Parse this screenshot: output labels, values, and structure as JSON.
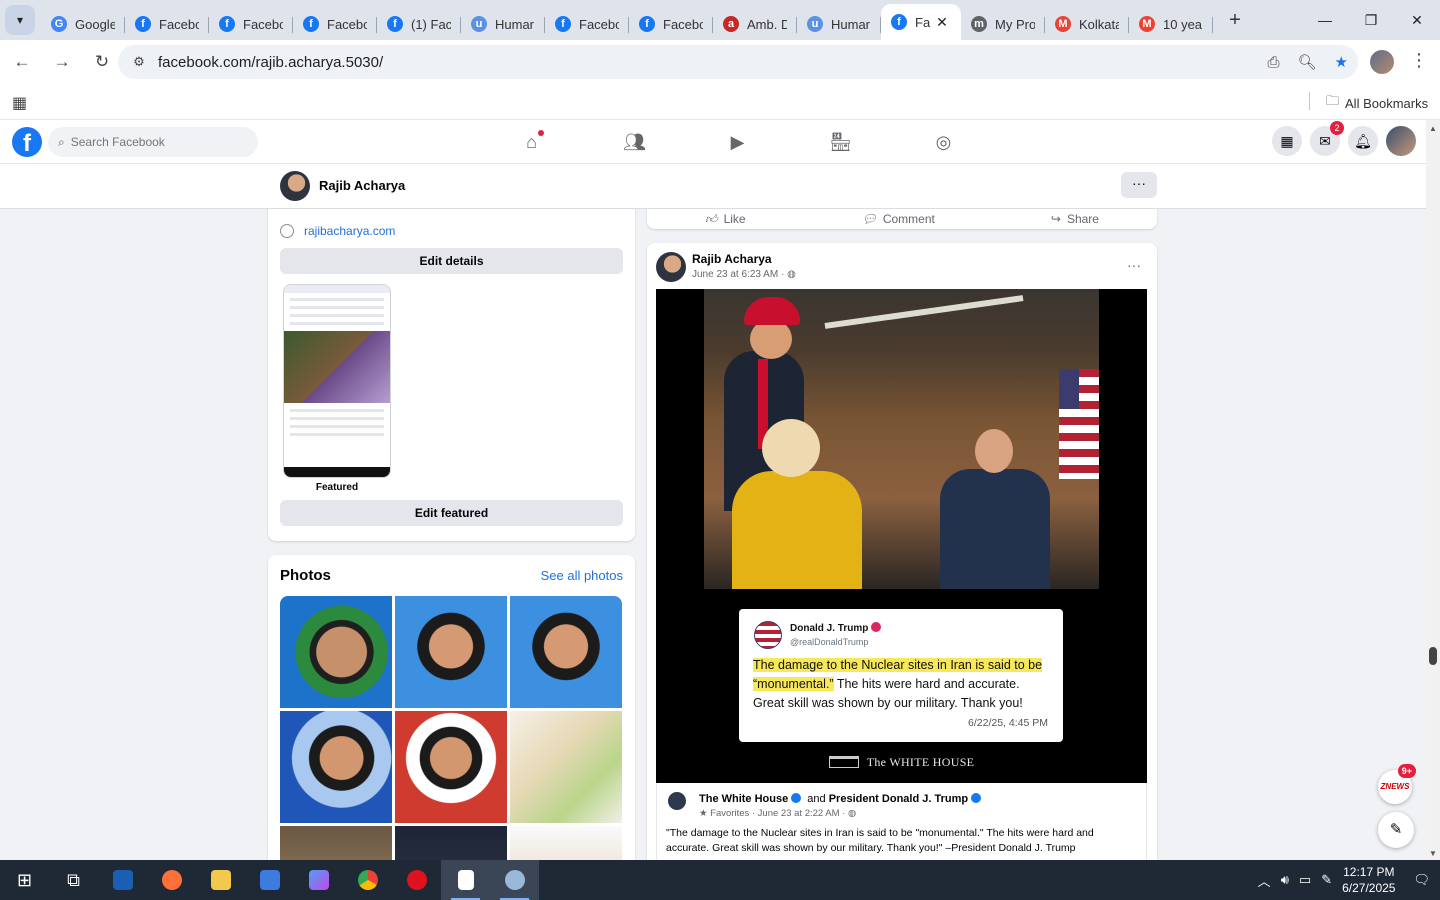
{
  "browser": {
    "tabs": [
      {
        "title": "Google",
        "favicon_color": "#4285f4",
        "favicon_glyph": "G"
      },
      {
        "title": "Facebo",
        "favicon_color": "#1877f2",
        "favicon_glyph": "f"
      },
      {
        "title": "Facebo",
        "favicon_color": "#1877f2",
        "favicon_glyph": "f"
      },
      {
        "title": "Facebo",
        "favicon_color": "#1877f2",
        "favicon_glyph": "f"
      },
      {
        "title": "(1) Fac",
        "favicon_color": "#1877f2",
        "favicon_glyph": "f"
      },
      {
        "title": "Humar",
        "favicon_color": "#5b92e5",
        "favicon_glyph": "u"
      },
      {
        "title": "Facebo",
        "favicon_color": "#1877f2",
        "favicon_glyph": "f"
      },
      {
        "title": "Facebo",
        "favicon_color": "#1877f2",
        "favicon_glyph": "f"
      },
      {
        "title": "Amb. D",
        "favicon_color": "#c62828",
        "favicon_glyph": "a"
      },
      {
        "title": "Humar",
        "favicon_color": "#5b92e5",
        "favicon_glyph": "u"
      },
      {
        "title": "Fa",
        "favicon_color": "#1877f2",
        "favicon_glyph": "f",
        "active": true
      },
      {
        "title": "My Pro",
        "favicon_color": "#5f6368",
        "favicon_glyph": "m"
      },
      {
        "title": "Kolkata",
        "favicon_color": "#ea4335",
        "favicon_glyph": "M"
      },
      {
        "title": "10 yea",
        "favicon_color": "#ea4335",
        "favicon_glyph": "M"
      }
    ],
    "url": "facebook.com/rajib.acharya.5030/",
    "all_bookmarks_label": "All Bookmarks"
  },
  "facebook": {
    "search_placeholder": "Search Facebook",
    "notifications": {
      "messenger_badge": "2"
    },
    "profile_bar": {
      "name": "Rajib Acharya",
      "more_label": "···"
    },
    "intro": {
      "website": "rajibacharya.com",
      "edit_details_label": "Edit details",
      "featured_label": "Featured",
      "edit_featured_label": "Edit featured"
    },
    "photos": {
      "title": "Photos",
      "see_all_label": "See all photos"
    },
    "prev_post_actions": {
      "like": "Like",
      "comment": "Comment",
      "share": "Share"
    },
    "post": {
      "author": "Rajib Acharya",
      "meta": "June 23 at 6:23 AM ·",
      "tweet": {
        "name": "Donald J. Trump",
        "handle": "@realDonaldTrump",
        "text_highlight": "The damage to the Nuclear sites in Iran is said to be “monumental.”",
        "text_rest": " The hits were hard and accurate. Great skill was shown by our military. Thank you!",
        "date": "6/22/25, 4:45 PM"
      },
      "watermark": "The WHITE HOUSE",
      "shared": {
        "author1": "The White House",
        "connector": "and",
        "author2": "President Donald J. Trump",
        "meta": "Favorites · June 23 at 2:22 AM ·",
        "text": "\"The damage to the Nuclear sites in Iran is said to be \"monumental.\" The hits were hard and accurate. Great skill was shown by our military. Thank you!\" –President Donald J. Trump"
      }
    },
    "floating": {
      "news_badge": "9+",
      "news_label": "ZNEWS"
    }
  },
  "taskbar": {
    "time": "12:17 PM",
    "date": "6/27/2025"
  }
}
